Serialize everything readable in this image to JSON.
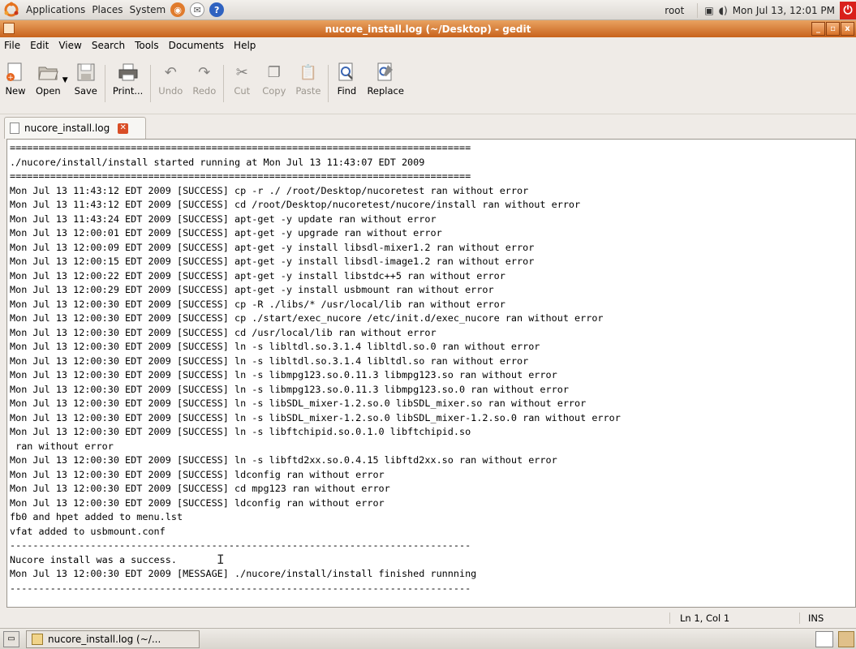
{
  "panel": {
    "menus": [
      "Applications",
      "Places",
      "System"
    ],
    "user": "root",
    "clock": "Mon Jul 13, 12:01 PM"
  },
  "window": {
    "title": "nucore_install.log (~/Desktop) - gedit",
    "controls": [
      "_",
      "▫",
      "x"
    ]
  },
  "menubar": [
    "File",
    "Edit",
    "View",
    "Search",
    "Tools",
    "Documents",
    "Help"
  ],
  "toolbar": {
    "new": "New",
    "open": "Open",
    "save": "Save",
    "print": "Print...",
    "undo": "Undo",
    "redo": "Redo",
    "cut": "Cut",
    "copy": "Copy",
    "paste": "Paste",
    "find": "Find",
    "replace": "Replace"
  },
  "tab": {
    "label": "nucore_install.log"
  },
  "document": {
    "text": "================================================================================\n./nucore/install/install started running at Mon Jul 13 11:43:07 EDT 2009\n================================================================================\nMon Jul 13 11:43:12 EDT 2009 [SUCCESS] cp -r ./ /root/Desktop/nucoretest ran without error\nMon Jul 13 11:43:12 EDT 2009 [SUCCESS] cd /root/Desktop/nucoretest/nucore/install ran without error\nMon Jul 13 11:43:24 EDT 2009 [SUCCESS] apt-get -y update ran without error\nMon Jul 13 12:00:01 EDT 2009 [SUCCESS] apt-get -y upgrade ran without error\nMon Jul 13 12:00:09 EDT 2009 [SUCCESS] apt-get -y install libsdl-mixer1.2 ran without error\nMon Jul 13 12:00:15 EDT 2009 [SUCCESS] apt-get -y install libsdl-image1.2 ran without error\nMon Jul 13 12:00:22 EDT 2009 [SUCCESS] apt-get -y install libstdc++5 ran without error\nMon Jul 13 12:00:29 EDT 2009 [SUCCESS] apt-get -y install usbmount ran without error\nMon Jul 13 12:00:30 EDT 2009 [SUCCESS] cp -R ./libs/* /usr/local/lib ran without error\nMon Jul 13 12:00:30 EDT 2009 [SUCCESS] cp ./start/exec_nucore /etc/init.d/exec_nucore ran without error\nMon Jul 13 12:00:30 EDT 2009 [SUCCESS] cd /usr/local/lib ran without error\nMon Jul 13 12:00:30 EDT 2009 [SUCCESS] ln -s libltdl.so.3.1.4 libltdl.so.0 ran without error\nMon Jul 13 12:00:30 EDT 2009 [SUCCESS] ln -s libltdl.so.3.1.4 libltdl.so ran without error\nMon Jul 13 12:00:30 EDT 2009 [SUCCESS] ln -s libmpg123.so.0.11.3 libmpg123.so ran without error\nMon Jul 13 12:00:30 EDT 2009 [SUCCESS] ln -s libmpg123.so.0.11.3 libmpg123.so.0 ran without error\nMon Jul 13 12:00:30 EDT 2009 [SUCCESS] ln -s libSDL_mixer-1.2.so.0 libSDL_mixer.so ran without error\nMon Jul 13 12:00:30 EDT 2009 [SUCCESS] ln -s libSDL_mixer-1.2.so.0 libSDL_mixer-1.2.so.0 ran without error\nMon Jul 13 12:00:30 EDT 2009 [SUCCESS] ln -s libftchipid.so.0.1.0 libftchipid.so\n ran without error\nMon Jul 13 12:00:30 EDT 2009 [SUCCESS] ln -s libftd2xx.so.0.4.15 libftd2xx.so ran without error\nMon Jul 13 12:00:30 EDT 2009 [SUCCESS] ldconfig ran without error\nMon Jul 13 12:00:30 EDT 2009 [SUCCESS] cd mpg123 ran without error\nMon Jul 13 12:00:30 EDT 2009 [SUCCESS] ldconfig ran without error\nfb0 and hpet added to menu.lst\nvfat added to usbmount.conf\n--------------------------------------------------------------------------------\nNucore install was a success.\nMon Jul 13 12:00:30 EDT 2009 [MESSAGE] ./nucore/install/install finished runnning\n--------------------------------------------------------------------------------"
  },
  "statusbar": {
    "position": "Ln 1, Col 1",
    "mode": "INS"
  },
  "taskbar": {
    "task_label": "nucore_install.log (~/..."
  },
  "colors": {
    "titlebar": "#d9782e",
    "panel": "#e6e2dc",
    "close_tab": "#d94e26"
  },
  "icons": {
    "panel_logo": "ubuntu-logo-icon",
    "tray_network": "network-icon",
    "tray_volume": "volume-icon",
    "power": "power-icon"
  }
}
